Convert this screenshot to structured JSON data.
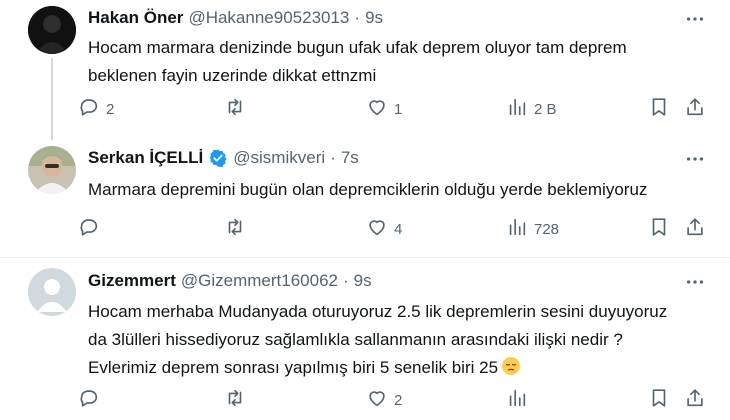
{
  "tweets": [
    {
      "name": "Hakan Öner",
      "handle": "@Hakanne90523013",
      "separator": "·",
      "time": "9s",
      "text": "Hocam marmara denizinde bugun ufak ufak deprem oluyor tam deprem beklenen fayin uzerinde dikkat ettnzmi",
      "replies": "2",
      "reposts": "",
      "likes": "1",
      "views": "2 B"
    },
    {
      "name": "Serkan İÇELLİ",
      "handle": "@sismikveri",
      "separator": "·",
      "time": "7s",
      "text": "Marmara depremini bugün olan depremciklerin olduğu yerde beklemiyoruz",
      "replies": "",
      "reposts": "",
      "likes": "4",
      "views": "728"
    },
    {
      "name": "Gizemmert",
      "handle": "@Gizemmert160062",
      "separator": "·",
      "time": "9s",
      "text": "Hocam merhaba Mudanyada oturuyoruz 2.5 lik depremlerin sesini duyuyoruz da 3lülleri hissediyoruz sağlamlıkla sallanmanın arasındaki ilişki nedir  ?  Evlerimiz deprem sonrası yapılmış biri 5 senelik biri 25",
      "replies": "",
      "reposts": "",
      "likes": "2",
      "views": ""
    }
  ],
  "icons": {
    "reply": "reply-icon",
    "repost": "repost-icon",
    "like": "like-icon",
    "views": "views-icon",
    "bookmark": "bookmark-icon",
    "share": "share-icon",
    "more": "more-icon",
    "verified": "verified-badge-icon",
    "emoji": "pensive-face-emoji"
  },
  "colors": {
    "text": "#0f1419",
    "secondary": "#536471",
    "verified": "#1d9bf0",
    "divider": "#eff3f4"
  }
}
